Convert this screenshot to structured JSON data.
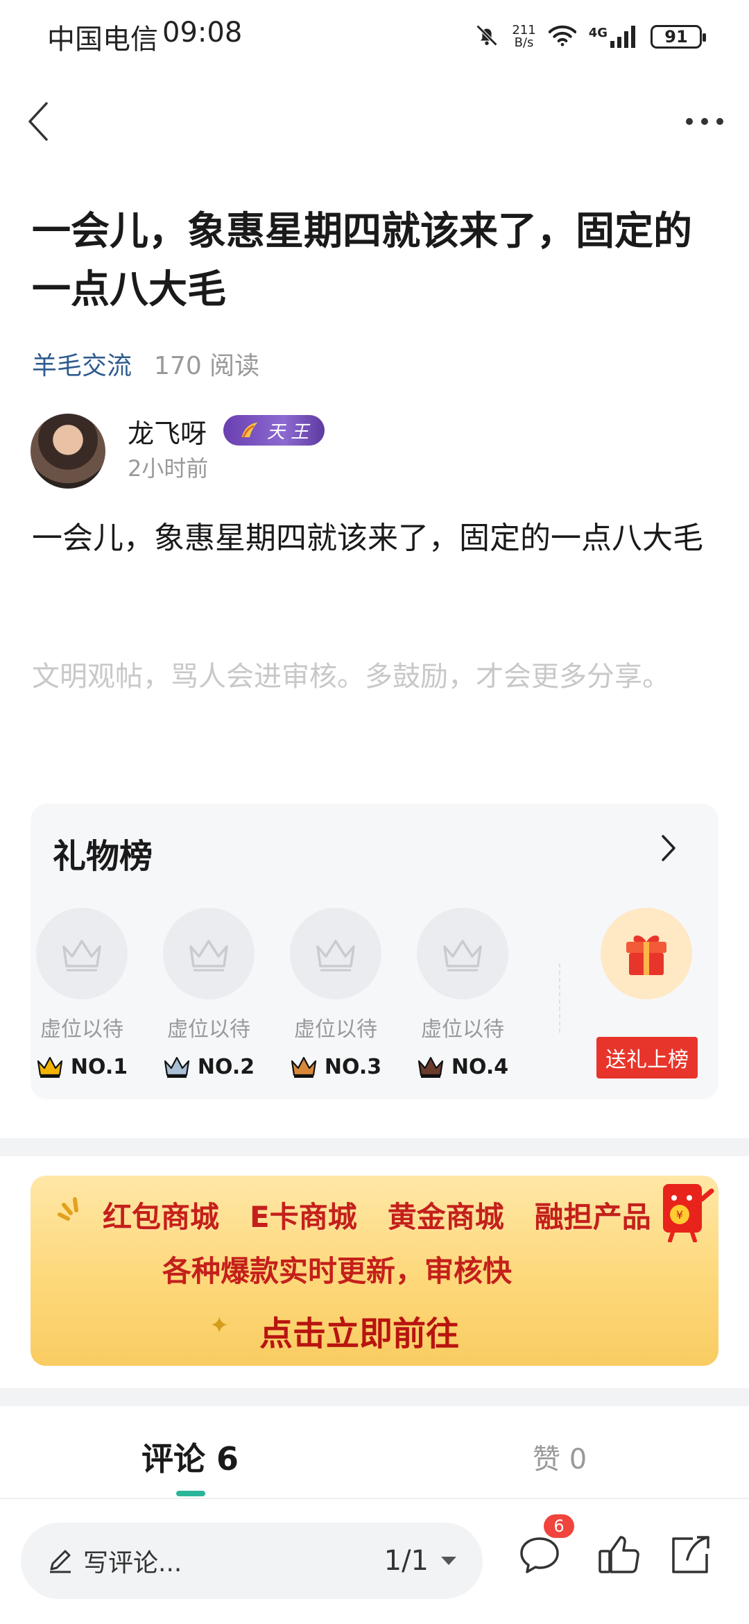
{
  "status_bar": {
    "carrier": "中国电信",
    "time": "09:08",
    "net_speed_value": "211",
    "net_speed_unit": "B/s",
    "network_type": "4G",
    "battery": "91",
    "icons": [
      "bell-mute-icon",
      "wifi-icon",
      "signal-icon",
      "battery-icon"
    ]
  },
  "nav": {
    "back_icon": "back-chevron-icon",
    "more_icon": "more-dots-icon"
  },
  "post": {
    "title": "一会儿，象惠星期四就该来了，固定的一点八大毛",
    "category": "羊毛交流",
    "reads": "170 阅读",
    "author": {
      "name": "龙飞呀",
      "badge": "天 王",
      "time": "2小时前"
    },
    "content": "一会儿，象惠星期四就该来了，固定的一点八大毛",
    "notice": "文明观帖，骂人会进审核。多鼓励，才会更多分享。"
  },
  "gift_board": {
    "title": "礼物榜",
    "slots": [
      {
        "label": "虚位以待",
        "rank": "NO.1",
        "crown_color": "#f2b400"
      },
      {
        "label": "虚位以待",
        "rank": "NO.2",
        "crown_color": "#a9c0d6"
      },
      {
        "label": "虚位以待",
        "rank": "NO.3",
        "crown_color": "#d9883a"
      },
      {
        "label": "虚位以待",
        "rank": "NO.4",
        "crown_color": "#6b3b2e"
      }
    ],
    "send_button": "送礼上榜"
  },
  "banner": {
    "row1": [
      "红包商城",
      "E卡商城",
      "黄金商城",
      "融担产品"
    ],
    "row2": "各种爆款实时更新，审核快",
    "row3": "点击立即前往"
  },
  "tabs": {
    "comments": "评论 6",
    "likes": "赞 0"
  },
  "bottom_bar": {
    "input_placeholder": "写评论...",
    "page": "1/1",
    "comment_badge": "6"
  },
  "colors": {
    "accent_green": "#2bb59a",
    "category_blue": "#2e5b8e",
    "gift_red": "#e8352b",
    "badge_red": "#f0443d"
  }
}
